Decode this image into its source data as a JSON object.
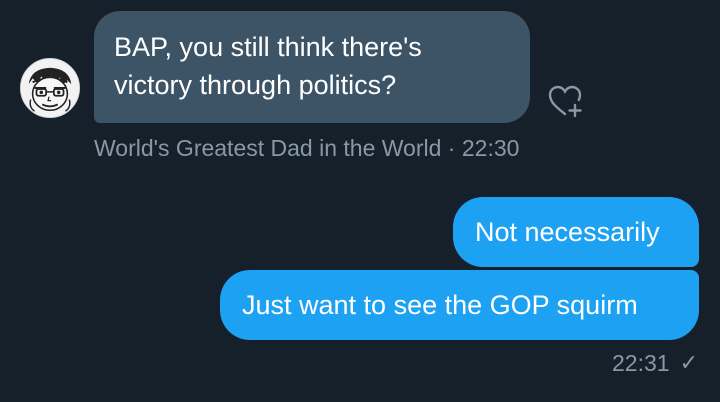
{
  "conversation": {
    "incoming": {
      "lines": [
        "BAP, you still think there's",
        "victory through politics?"
      ],
      "sender": "World's Greatest Dad in the World",
      "separator": "·",
      "time": "22:30",
      "avatar_icon": "cartoon-face-avatar",
      "action_icon": "heart-plus-icon"
    },
    "outgoing": {
      "messages": [
        "Not necessarily",
        "Just want to see the GOP squirm"
      ],
      "time": "22:31",
      "status_icon": "✓"
    }
  },
  "colors": {
    "background": "#15202b",
    "incoming_bubble": "#3d5466",
    "outgoing_bubble": "#1da1f2",
    "meta_text": "#8899a6"
  }
}
